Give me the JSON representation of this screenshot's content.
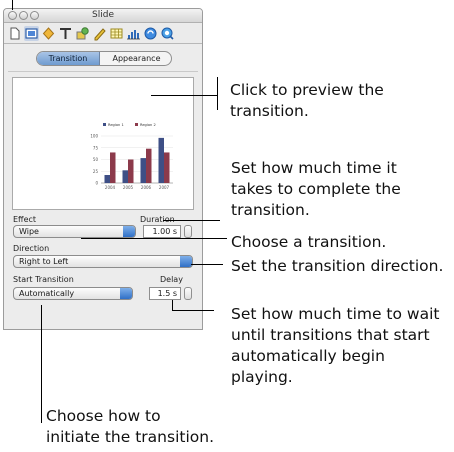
{
  "window": {
    "title": "Slide"
  },
  "tabs": {
    "transition": "Transition",
    "appearance": "Appearance"
  },
  "preview": {
    "chart_data": {
      "type": "bar",
      "categories": [
        "2004",
        "2005",
        "2006",
        "2007"
      ],
      "series": [
        {
          "name": "Region 1",
          "values": [
            17,
            27,
            53,
            96
          ]
        },
        {
          "name": "Region 2",
          "values": [
            65,
            50,
            73,
            65
          ]
        }
      ],
      "ylim": [
        0,
        100
      ],
      "yticks": [
        "0",
        "25",
        "50",
        "75",
        "100"
      ],
      "colors": {
        "Region 1": "#3e4f86",
        "Region 2": "#8c3a4b"
      },
      "legend": "top",
      "grid": true
    }
  },
  "effect": {
    "label": "Effect",
    "value": "Wipe"
  },
  "duration": {
    "label": "Duration",
    "value": "1.00 s"
  },
  "direction": {
    "label": "Direction",
    "value": "Right to Left"
  },
  "start_transition": {
    "label": "Start Transition",
    "value": "Automatically"
  },
  "delay": {
    "label": "Delay",
    "value": "1.5 s"
  },
  "callouts": {
    "preview": [
      "Click to preview the",
      "transition."
    ],
    "duration": [
      "Set how much time it",
      "takes to complete the",
      "transition."
    ],
    "effect": [
      "Choose a transition."
    ],
    "direction": [
      "Set the transition direction."
    ],
    "delay": [
      "Set how much time to wait",
      "until transitions that start",
      "automatically begin",
      "playing."
    ],
    "start": [
      "Choose how to",
      "initiate the transition."
    ]
  },
  "icons": [
    "slide-icon",
    "document-icon",
    "graphic-icon",
    "text-icon",
    "shape-icon",
    "metrics-icon",
    "table-icon",
    "chart-icon",
    "link-icon",
    "quicktime-icon"
  ]
}
